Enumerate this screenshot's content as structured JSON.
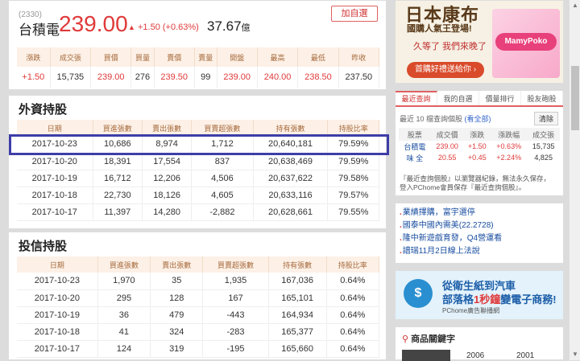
{
  "quote": {
    "code": "(2330)",
    "name": "台積電",
    "price": "239.00",
    "change": "+1.50 (+0.63%)",
    "pe": "37.67",
    "pe_unit": "億",
    "add_button": "加自選",
    "headers": [
      "漲跌",
      "成交張",
      "買價",
      "買量",
      "賣價",
      "賣量",
      "開盤",
      "最高",
      "最低",
      "昨收"
    ],
    "values": [
      "+1.50",
      "15,735",
      "239.00",
      "276",
      "239.50",
      "99",
      "239.00",
      "240.00",
      "238.50",
      "237.50"
    ]
  },
  "foreign": {
    "title": "外資持股",
    "headers": [
      "日期",
      "買進張數",
      "賣出張數",
      "買賣超張數",
      "持有張數",
      "持股比率"
    ],
    "rows": [
      [
        "2017-10-23",
        "10,686",
        "8,974",
        "1,712",
        "20,640,181",
        "79.59%"
      ],
      [
        "2017-10-20",
        "18,391",
        "17,554",
        "837",
        "20,638,469",
        "79.59%"
      ],
      [
        "2017-10-19",
        "16,712",
        "12,206",
        "4,506",
        "20,637,622",
        "79.58%"
      ],
      [
        "2017-10-18",
        "22,730",
        "18,126",
        "4,605",
        "20,633,116",
        "79.57%"
      ],
      [
        "2017-10-17",
        "11,397",
        "14,280",
        "-2,882",
        "20,628,661",
        "79.55%"
      ]
    ]
  },
  "trust": {
    "title": "投信持股",
    "headers": [
      "日期",
      "買進張數",
      "賣出張數",
      "買賣超張數",
      "持有張數",
      "持股比率"
    ],
    "rows": [
      [
        "2017-10-23",
        "1,970",
        "35",
        "1,935",
        "167,036",
        "0.64%"
      ],
      [
        "2017-10-20",
        "295",
        "128",
        "167",
        "165,101",
        "0.64%"
      ],
      [
        "2017-10-19",
        "36",
        "479",
        "-443",
        "164,934",
        "0.64%"
      ],
      [
        "2017-10-18",
        "41",
        "324",
        "-283",
        "165,377",
        "0.64%"
      ],
      [
        "2017-10-17",
        "124",
        "319",
        "-195",
        "165,660",
        "0.64%"
      ]
    ]
  },
  "ad1": {
    "line1": "日本康布",
    "line2": "國購人氣王登場!",
    "line3": "久等了 我們來晚了",
    "cta": "首購好禮送給你 ›",
    "logo": "MamyPoko"
  },
  "recent": {
    "tabs": [
      "最近查詢",
      "我的自選",
      "價量排行",
      "股友砲股"
    ],
    "info": "最近 10 檔查詢個股",
    "info_link": "(看全部)",
    "clear": "清除",
    "headers": [
      "股票",
      "成交價",
      "漲跌",
      "漲跌幅",
      "成交張"
    ],
    "rows": [
      [
        "台積電",
        "239.00",
        "+1.50",
        "+0.63%",
        "15,735"
      ],
      [
        "味 全",
        "20.55",
        "+0.45",
        "+2.24%",
        "4,825"
      ]
    ],
    "note1": "『最近查詢個股』以瀏覽器紀錄，無法永久保存，",
    "note2": "登入PChome會員保存『最近查詢個股』。"
  },
  "news": [
    "業績擇購，富宇選停",
    "國泰中國內需美(22.2728)",
    "隆中新遊戲育發，Q4營運看",
    "譜瑞11月2日線上法說"
  ],
  "ad2": {
    "line1": "從衛生紙到汽車",
    "line2_pre": "部落格",
    "line2_hi": "1秒鐘",
    "line2_post": "變電子商務!",
    "line3": "PChome廣告聯播網",
    "icon": "$"
  },
  "keywords": {
    "title": "商品關鍵字",
    "y1": "2006",
    "y2": "2001"
  },
  "colors": {
    "up": "#e03a3a",
    "header_bg": "#fdf0e6",
    "highlight": "#3d3da8"
  }
}
